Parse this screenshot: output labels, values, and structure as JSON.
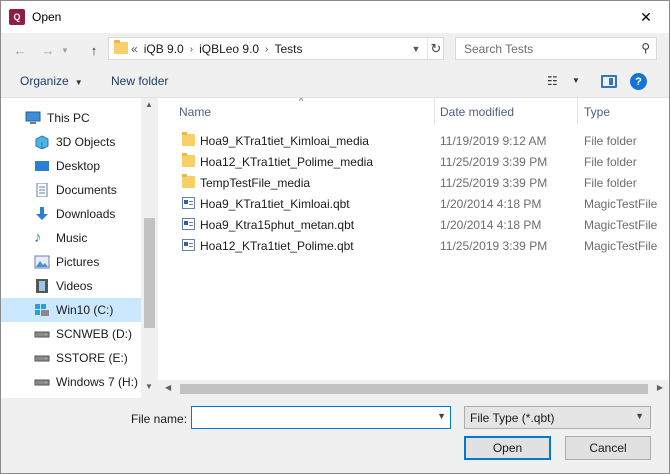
{
  "window": {
    "title": "Open",
    "app_icon_text": "Q"
  },
  "address": {
    "crumbs": [
      "iQB 9.0",
      "iQBLeo 9.0",
      "Tests"
    ],
    "overflow": "«"
  },
  "search": {
    "placeholder": "Search Tests"
  },
  "toolbar": {
    "organize_label": "Organize",
    "new_folder_label": "New folder"
  },
  "nav_pane": {
    "items": [
      {
        "label": "This PC",
        "icon": "computer-icon",
        "level": 0
      },
      {
        "label": "3D Objects",
        "icon": "cube-icon",
        "level": 1
      },
      {
        "label": "Desktop",
        "icon": "desktop-icon",
        "level": 1
      },
      {
        "label": "Documents",
        "icon": "documents-icon",
        "level": 1
      },
      {
        "label": "Downloads",
        "icon": "download-arrow-icon",
        "level": 1
      },
      {
        "label": "Music",
        "icon": "music-note-icon",
        "level": 1
      },
      {
        "label": "Pictures",
        "icon": "pictures-icon",
        "level": 1
      },
      {
        "label": "Videos",
        "icon": "film-icon",
        "level": 1
      },
      {
        "label": "Win10 (C:)",
        "icon": "windows-drive-icon",
        "level": 1,
        "selected": true
      },
      {
        "label": "SCNWEB (D:)",
        "icon": "drive-icon",
        "level": 1
      },
      {
        "label": "SSTORE (E:)",
        "icon": "drive-icon",
        "level": 1
      },
      {
        "label": "Windows 7 (H:)",
        "icon": "drive-icon",
        "level": 1
      }
    ]
  },
  "file_list": {
    "columns": {
      "name": "Name",
      "date": "Date modified",
      "type": "Type"
    },
    "rows": [
      {
        "name": "Hoa9_KTra1tiet_Kimloai_media",
        "date": "11/19/2019 9:12 AM",
        "type": "File folder",
        "kind": "folder"
      },
      {
        "name": "Hoa12_KTra1tiet_Polime_media",
        "date": "11/25/2019 3:39 PM",
        "type": "File folder",
        "kind": "folder"
      },
      {
        "name": "TempTestFile_media",
        "date": "11/25/2019 3:39 PM",
        "type": "File folder",
        "kind": "folder"
      },
      {
        "name": "Hoa9_KTra1tiet_Kimloai.qbt",
        "date": "1/20/2014 4:18 PM",
        "type": "MagicTestFile",
        "kind": "file"
      },
      {
        "name": "Hoa9_Ktra15phut_metan.qbt",
        "date": "1/20/2014 4:18 PM",
        "type": "MagicTestFile",
        "kind": "file"
      },
      {
        "name": "Hoa12_KTra1tiet_Polime.qbt",
        "date": "11/25/2019 3:39 PM",
        "type": "MagicTestFile",
        "kind": "file"
      }
    ]
  },
  "bottom": {
    "file_name_label": "File name:",
    "file_name_value": "",
    "file_type_value": "File Type (*.qbt)",
    "open_label": "Open",
    "cancel_label": "Cancel"
  },
  "colors": {
    "accent": "#0078d7",
    "selection": "#cce8ff",
    "folder": "#f7d06a"
  }
}
